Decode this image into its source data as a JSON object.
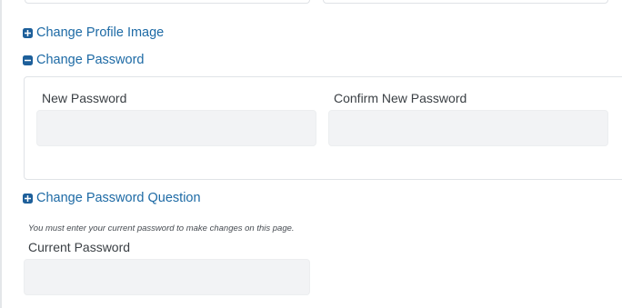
{
  "sections": {
    "profile_image": {
      "label": "Change Profile Image",
      "state": "collapsed"
    },
    "password": {
      "label": "Change Password",
      "state": "expanded"
    },
    "password_question": {
      "label": "Change Password Question",
      "state": "collapsed"
    }
  },
  "password_form": {
    "new_password": {
      "label": "New Password",
      "value": ""
    },
    "confirm_password": {
      "label": "Confirm New Password",
      "value": ""
    }
  },
  "current_password": {
    "note": "You must enter your current password to make changes on this page.",
    "label": "Current Password",
    "value": ""
  },
  "colors": {
    "link": "#1d6aa5",
    "icon": "#1d5f9a",
    "input_bg": "#f2f3f5"
  },
  "icons": {
    "expand": "plus-square-icon",
    "collapse": "minus-square-icon"
  }
}
